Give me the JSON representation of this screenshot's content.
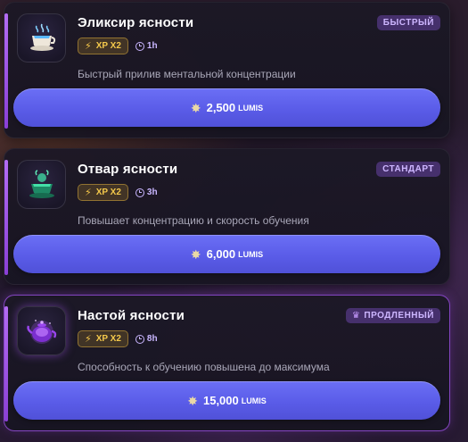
{
  "items": [
    {
      "title": "Эликсир ясности",
      "tier": "БЫСТРЫЙ",
      "xp": "XP X2",
      "duration": "1h",
      "description": "Быстрый прилив ментальной концентрации",
      "price": "2,500",
      "currency": "LUMIS",
      "icon": "teacup-icon",
      "accent": "#79c6ff"
    },
    {
      "title": "Отвар ясности",
      "tier": "СТАНДАРТ",
      "xp": "XP X2",
      "duration": "3h",
      "description": "Повышает концентрацию и скорость обучения",
      "price": "6,000",
      "currency": "LUMIS",
      "icon": "herbal-bowl-icon",
      "accent": "#3ed3a0"
    },
    {
      "title": "Настой ясности",
      "tier": "ПРОДЛЕННЫЙ",
      "xp": "XP X2",
      "duration": "8h",
      "description": "Способность к обучению повышена до максимума",
      "price": "15,000",
      "currency": "LUMIS",
      "icon": "teapot-icon",
      "accent": "#a855f7"
    }
  ]
}
